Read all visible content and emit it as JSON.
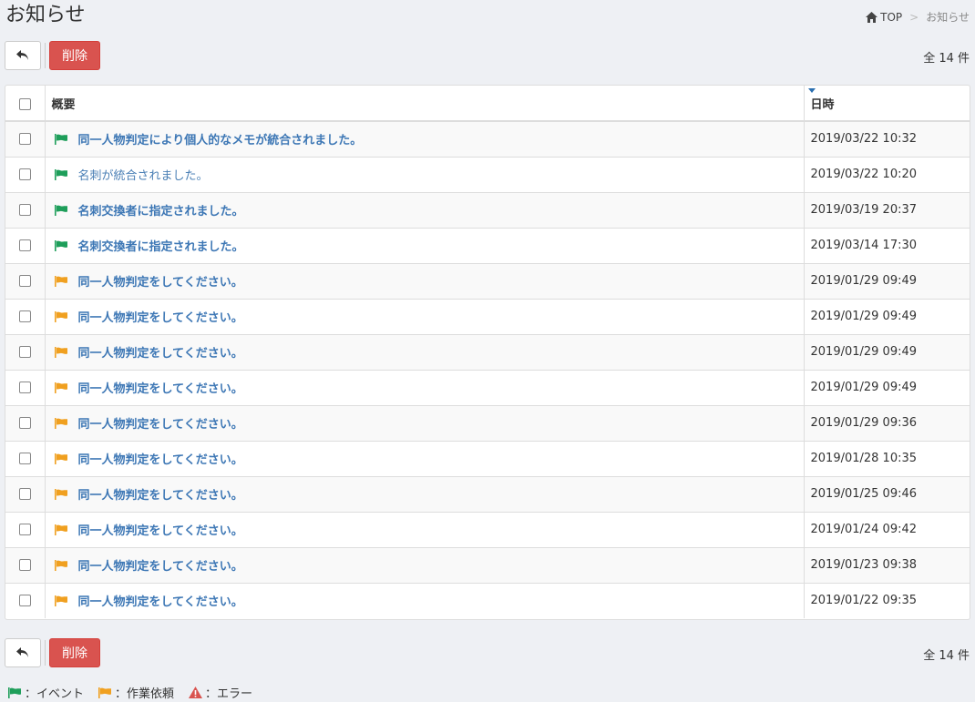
{
  "page": {
    "title": "お知らせ"
  },
  "breadcrumb": {
    "home_label": "TOP",
    "separator": ">",
    "current": "お知らせ"
  },
  "toolbar": {
    "delete_label": "削除",
    "count_label": "全 14 件"
  },
  "table": {
    "headers": {
      "summary": "概要",
      "datetime": "日時"
    },
    "rows": [
      {
        "type": "event",
        "read": false,
        "summary": "同一人物判定により個人的なメモが統合されました。",
        "datetime": "2019/03/22 10:32"
      },
      {
        "type": "event",
        "read": true,
        "summary": "名刺が統合されました。",
        "datetime": "2019/03/22 10:20"
      },
      {
        "type": "event",
        "read": false,
        "summary": "名刺交換者に指定されました。",
        "datetime": "2019/03/19 20:37"
      },
      {
        "type": "event",
        "read": false,
        "summary": "名刺交換者に指定されました。",
        "datetime": "2019/03/14 17:30"
      },
      {
        "type": "task",
        "read": false,
        "summary": "同一人物判定をしてください。",
        "datetime": "2019/01/29 09:49"
      },
      {
        "type": "task",
        "read": false,
        "summary": "同一人物判定をしてください。",
        "datetime": "2019/01/29 09:49"
      },
      {
        "type": "task",
        "read": false,
        "summary": "同一人物判定をしてください。",
        "datetime": "2019/01/29 09:49"
      },
      {
        "type": "task",
        "read": false,
        "summary": "同一人物判定をしてください。",
        "datetime": "2019/01/29 09:49"
      },
      {
        "type": "task",
        "read": false,
        "summary": "同一人物判定をしてください。",
        "datetime": "2019/01/29 09:36"
      },
      {
        "type": "task",
        "read": false,
        "summary": "同一人物判定をしてください。",
        "datetime": "2019/01/28 10:35"
      },
      {
        "type": "task",
        "read": false,
        "summary": "同一人物判定をしてください。",
        "datetime": "2019/01/25 09:46"
      },
      {
        "type": "task",
        "read": false,
        "summary": "同一人物判定をしてください。",
        "datetime": "2019/01/24 09:42"
      },
      {
        "type": "task",
        "read": false,
        "summary": "同一人物判定をしてください。",
        "datetime": "2019/01/23 09:38"
      },
      {
        "type": "task",
        "read": false,
        "summary": "同一人物判定をしてください。",
        "datetime": "2019/01/22 09:35"
      }
    ]
  },
  "legend": {
    "event": "：イベント",
    "task": "：作業依頼",
    "error": "：エラー"
  },
  "colors": {
    "event_flag": "#1e9e5a",
    "task_flag": "#f0a020",
    "error_icon": "#d9534f",
    "delete_button": "#d9534f",
    "link": "#3d77b5"
  },
  "icons": {
    "home": "home-icon",
    "back": "reply-arrow-icon",
    "event": "green-flag-icon",
    "task": "orange-flag-icon",
    "error": "warning-triangle-icon"
  }
}
